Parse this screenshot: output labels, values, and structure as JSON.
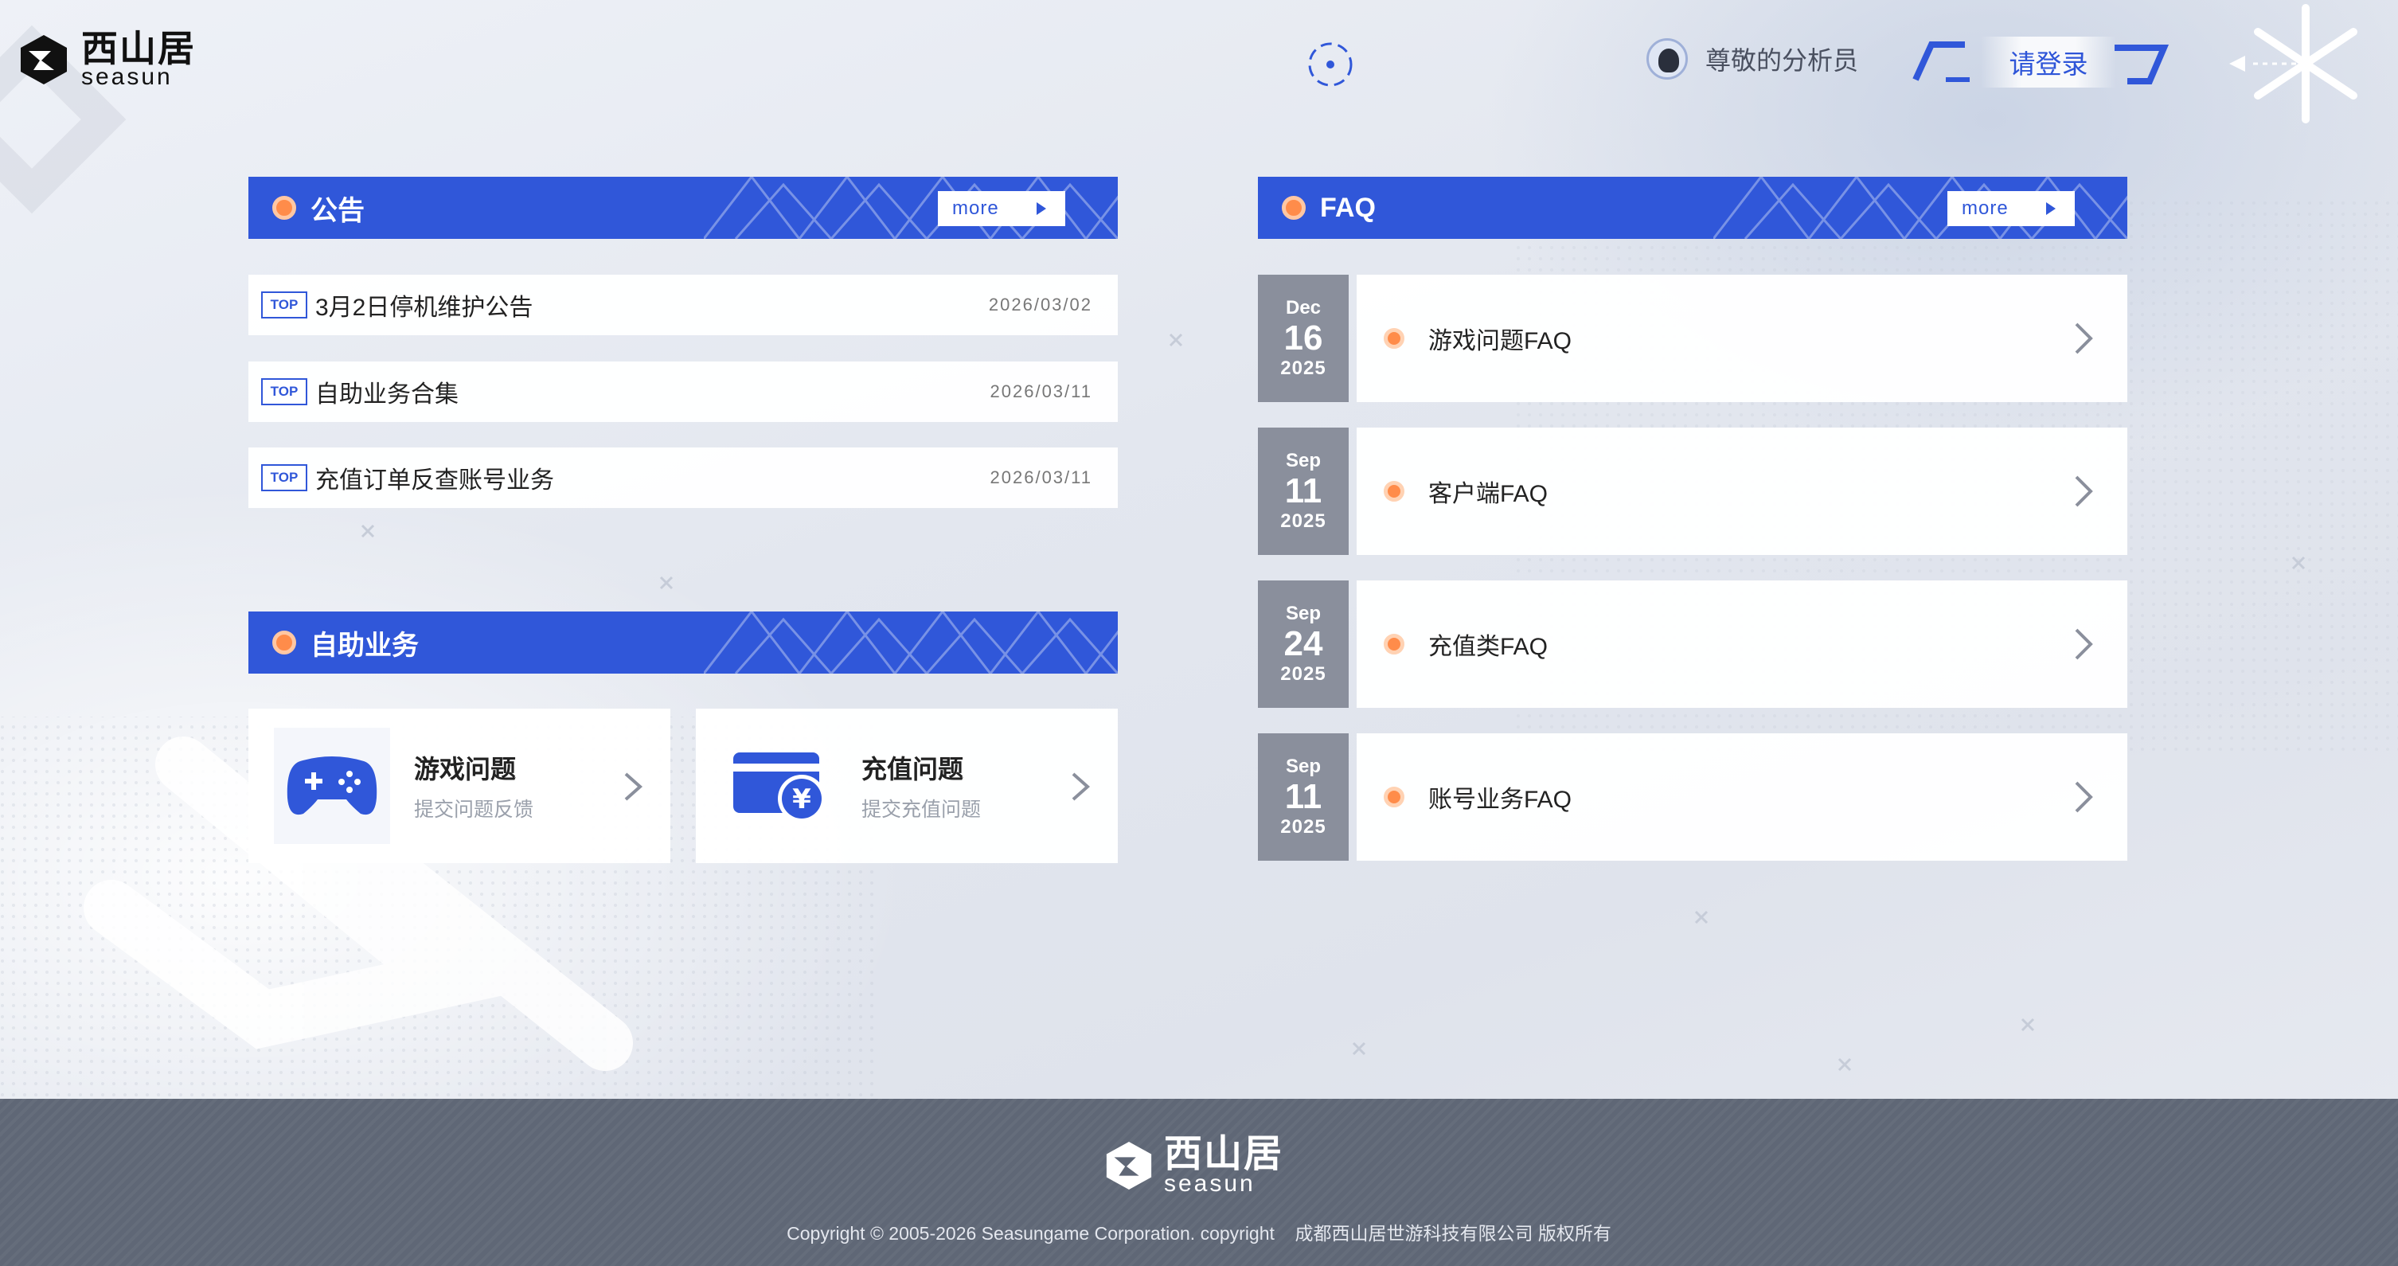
{
  "header": {
    "logo_cn": "西山居",
    "logo_en": "seasun",
    "user_name": "尊敬的分析员",
    "login_label": "请登录"
  },
  "notices": {
    "title": "公告",
    "more_label": "more",
    "items": [
      {
        "tag": "TOP",
        "title": "3月2日停机维护公告",
        "date": "2026/03/02"
      },
      {
        "tag": "TOP",
        "title": "自助业务合集",
        "date": "2026/03/11"
      },
      {
        "tag": "TOP",
        "title": "充值订单反查账号业务",
        "date": "2026/03/11"
      }
    ]
  },
  "self_service": {
    "title": "自助业务",
    "items": [
      {
        "title": "游戏问题",
        "subtitle": "提交问题反馈",
        "icon": "gamepad-icon"
      },
      {
        "title": "充值问题",
        "subtitle": "提交充值问题",
        "icon": "payment-card-icon"
      }
    ]
  },
  "faq": {
    "title": "FAQ",
    "more_label": "more",
    "items": [
      {
        "month": "Dec",
        "day": "16",
        "year": "2025",
        "title": "游戏问题FAQ"
      },
      {
        "month": "Sep",
        "day": "11",
        "year": "2025",
        "title": "客户端FAQ"
      },
      {
        "month": "Sep",
        "day": "24",
        "year": "2025",
        "title": "充值类FAQ"
      },
      {
        "month": "Sep",
        "day": "11",
        "year": "2025",
        "title": "账号业务FAQ"
      }
    ]
  },
  "footer": {
    "logo_cn": "西山居",
    "logo_en": "seasun",
    "copyright": "Copyright © 2005-2026 Seasungame Corporation. copyright    成都西山居世游科技有限公司 版权所有"
  },
  "colors": {
    "primary_blue": "#3057d9",
    "accent_orange": "#ff8c4a",
    "footer_bg": "#5f6776",
    "date_tile": "#8a8f9c"
  }
}
